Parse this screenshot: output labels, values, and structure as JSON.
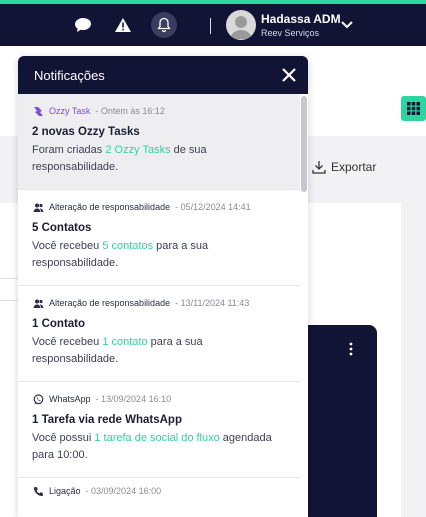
{
  "header": {
    "user": {
      "name": "Hadassa ADM",
      "company": "Reev Serviços"
    },
    "icons": [
      "chat-icon",
      "alert-icon",
      "bell-icon",
      "chevron-down-icon"
    ]
  },
  "background": {
    "export_label": "Exportar"
  },
  "notifications": {
    "title": "Notificações",
    "items": [
      {
        "source": "Ozzy Task",
        "date": " - Ontem às 16:12",
        "title": "2 novas Ozzy Tasks",
        "body_pre": "Foram criadas ",
        "body_hl": "2 Ozzy Tasks",
        "body_post": " de sua responsabilidade.",
        "icon": "ozzy-icon"
      },
      {
        "source": "Alteração de responsabilidade",
        "date": " - 05/12/2024 14:41",
        "title": "5 Contatos",
        "body_pre": "Você recebeu ",
        "body_hl": "5 contatos",
        "body_post": " para a sua responsabilidade.",
        "icon": "users-icon"
      },
      {
        "source": "Alteração de responsabilidade",
        "date": " - 13/11/2024 11:43",
        "title": "1 Contato",
        "body_pre": "Você recebeu ",
        "body_hl": "1 contato",
        "body_post": " para a sua responsabilidade.",
        "icon": "users-icon"
      },
      {
        "source": "WhatsApp",
        "date": " - 13/09/2024 16:10",
        "title": "1 Tarefa via rede WhatsApp",
        "body_pre": "Você possui ",
        "body_hl": "1 tarefa de social do fluxo",
        "body_post": " agendada para 10:00.",
        "icon": "whatsapp-icon"
      },
      {
        "source": "Ligação",
        "date": " - 03/09/2024 16:00",
        "icon": "phone-icon"
      }
    ]
  },
  "colors": {
    "navy": "#121436",
    "accent": "#2ed3a0",
    "purple": "#7a4fd6"
  }
}
